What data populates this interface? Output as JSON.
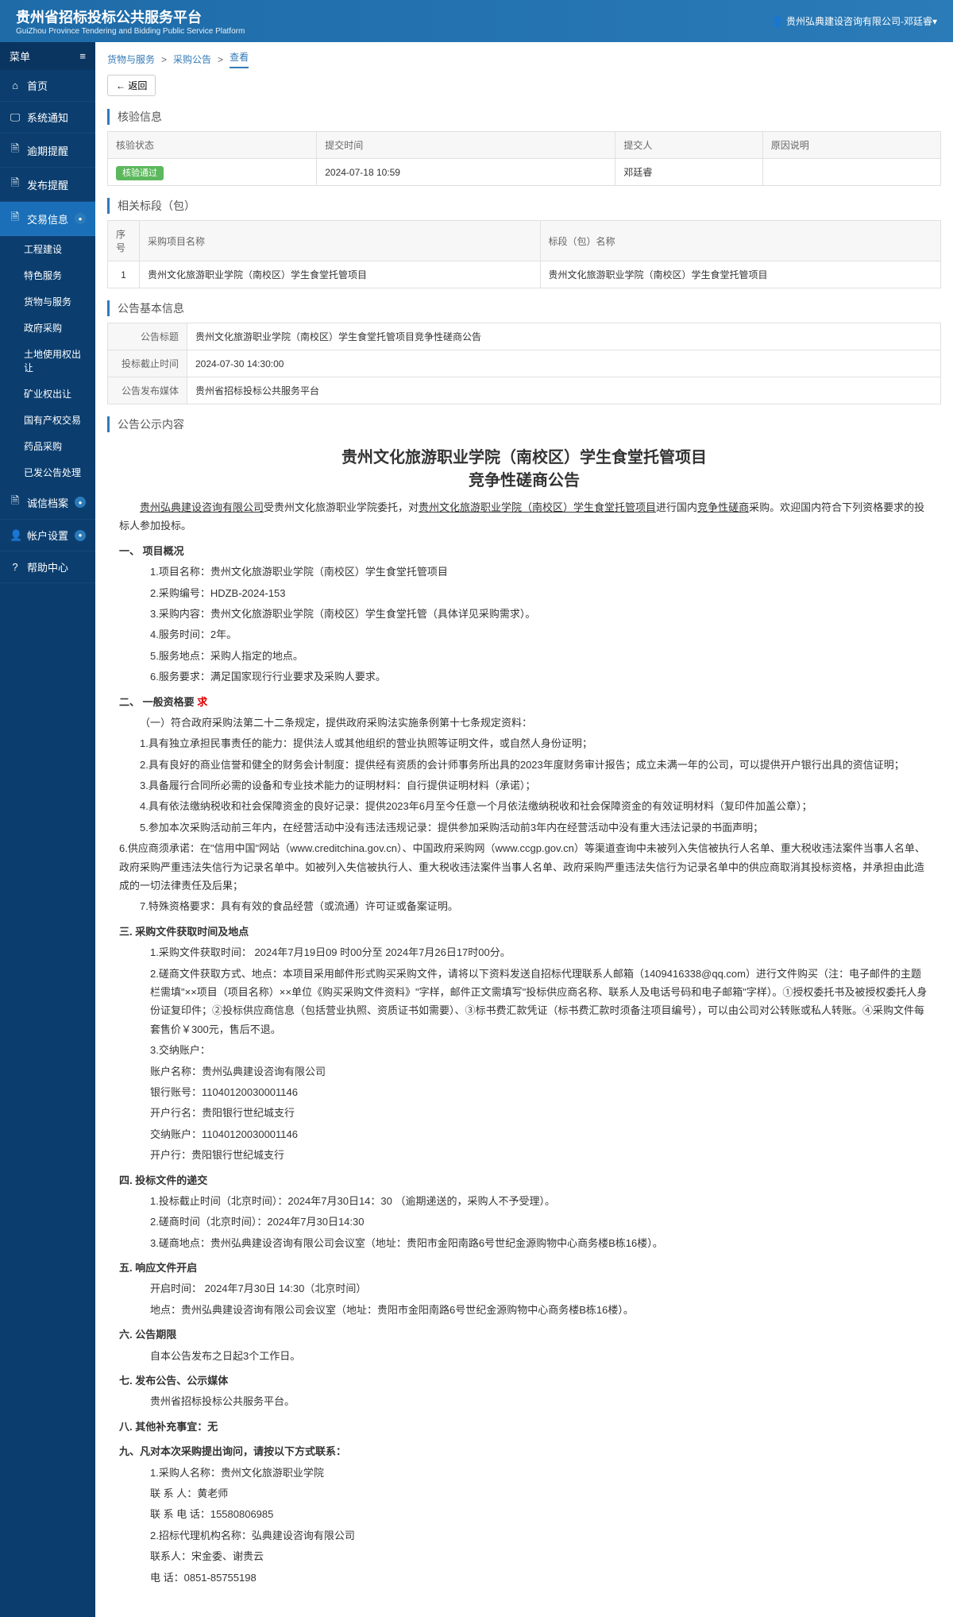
{
  "header": {
    "title": "贵州省招标投标公共服务平台",
    "subtitle": "GuiZhou Province Tendering and Bidding Public Service Platform",
    "user": "贵州弘典建设咨询有限公司-邓廷睿"
  },
  "sidebar": {
    "menu_label": "菜单",
    "items": [
      {
        "icon": "⌂",
        "label": "首页"
      },
      {
        "icon": "🖵",
        "label": "系统通知"
      },
      {
        "icon": "🗎",
        "label": "逾期提醒"
      },
      {
        "icon": "🗎",
        "label": "发布提醒"
      },
      {
        "icon": "🗎",
        "label": "交易信息",
        "active": true,
        "badge": true
      }
    ],
    "subitems": [
      {
        "label": "工程建设"
      },
      {
        "label": "特色服务"
      },
      {
        "label": "货物与服务"
      },
      {
        "label": "政府采购"
      },
      {
        "label": "土地使用权出让"
      },
      {
        "label": "矿业权出让"
      },
      {
        "label": "国有产权交易"
      },
      {
        "label": "药品采购"
      },
      {
        "label": "已发公告处理"
      }
    ],
    "bottom_items": [
      {
        "icon": "🗎",
        "label": "诚信档案",
        "badge": true
      },
      {
        "icon": "👤",
        "label": "帐户设置",
        "badge": true
      },
      {
        "icon": "?",
        "label": "帮助中心"
      }
    ]
  },
  "breadcrumb": {
    "items": [
      "货物与服务",
      "采购公告",
      "查看"
    ]
  },
  "back_btn": "← 返回",
  "verify": {
    "title": "核验信息",
    "headers": [
      "核验状态",
      "提交时间",
      "提交人",
      "原因说明"
    ],
    "status": "核验通过",
    "time": "2024-07-18 10:59",
    "person": "邓廷睿",
    "reason": ""
  },
  "section": {
    "title": "相关标段（包）",
    "headers": [
      "序号",
      "采购项目名称",
      "标段（包）名称"
    ],
    "rows": [
      {
        "no": "1",
        "proj": "贵州文化旅游职业学院（南校区）学生食堂托管项目",
        "pkg": "贵州文化旅游职业学院（南校区）学生食堂托管项目"
      }
    ]
  },
  "basic": {
    "title": "公告基本信息",
    "rows": [
      {
        "label": "公告标题",
        "value": "贵州文化旅游职业学院（南校区）学生食堂托管项目竞争性磋商公告"
      },
      {
        "label": "投标截止时间",
        "value": "2024-07-30 14:30:00"
      },
      {
        "label": "公告发布媒体",
        "value": "贵州省招标投标公共服务平台"
      }
    ]
  },
  "notice": {
    "panel_title": "公告公示内容",
    "title1": "贵州文化旅游职业学院（南校区）学生食堂托管项目",
    "title2": "竞争性磋商公告",
    "intro_a": "贵州弘典建设咨询有限公司",
    "intro_b": "受贵州文化旅游职业学院委托，对",
    "intro_c": "贵州文化旅游职业学院（南校区）学生食堂托管项目",
    "intro_d": "进行国内",
    "intro_e": "竞争性磋商",
    "intro_f": "采购。欢迎国内符合下列资格要求的投标人参加投标。",
    "s1_title": "一、  项目概况",
    "s1_1": "1.项目名称：贵州文化旅游职业学院（南校区）学生食堂托管项目",
    "s1_2": "2.采购编号：HDZB-2024-153",
    "s1_3": "3.采购内容：贵州文化旅游职业学院（南校区）学生食堂托管（具体详见采购需求）。",
    "s1_4": "4.服务时间：2年。",
    "s1_5": "5.服务地点：采购人指定的地点。",
    "s1_6": "6.服务要求：满足国家现行行业要求及采购人要求。",
    "s2_title": "二、  一般资格要",
    "s2_1": "（一）符合政府采购法第二十二条规定，提供政府采购法实施条例第十七条规定资料：",
    "s2_2": "1.具有独立承担民事责任的能力：提供法人或其他组织的营业执照等证明文件，或自然人身份证明；",
    "s2_3": "2.具有良好的商业信誉和健全的财务会计制度：提供经有资质的会计师事务所出具的2023年度财务审计报告；成立未满一年的公司，可以提供开户银行出具的资信证明；",
    "s2_4": "3.具备履行合同所必需的设备和专业技术能力的证明材料：自行提供证明材料（承诺）；",
    "s2_5": "4.具有依法缴纳税收和社会保障资金的良好记录：提供2023年6月至今任意一个月依法缴纳税收和社会保障资金的有效证明材料（复印件加盖公章）；",
    "s2_6": "5.参加本次采购活动前三年内，在经营活动中没有违法违规记录：提供参加采购活动前3年内在经营活动中没有重大违法记录的书面声明；",
    "s2_7": "6.供应商须承诺：在\"信用中国\"网站（www.creditchina.gov.cn）、中国政府采购网（www.ccgp.gov.cn）等渠道查询中未被列入失信被执行人名单、重大税收违法案件当事人名单、政府采购严重违法失信行为记录名单中。如被列入失信被执行人、重大税收违法案件当事人名单、政府采购严重违法失信行为记录名单中的供应商取消其投标资格，并承担由此造成的一切法律责任及后果；",
    "s2_8": "7.特殊资格要求：具有有效的食品经营（或流通）许可证或备案证明。",
    "s3_title": "三. 采购文件获取时间及地点",
    "s3_1": "1.采购文件获取时间：  2024年7月19日09 时00分至  2024年7月26日17时00分。",
    "s3_2": "2.磋商文件获取方式、地点：本项目采用邮件形式购买采购文件，请将以下资料发送自招标代理联系人邮箱（1409416338@qq.com）进行文件购买（注：电子邮件的主题栏需填\"××项目（项目名称）××单位《购买采购文件资料》\"字样，邮件正文需填写\"投标供应商名称、联系人及电话号码和电子邮箱\"字样）。①授权委托书及被授权委托人身份证复印件；②投标供应商信息（包括营业执照、资质证书如需要）、③标书费汇款凭证（标书费汇款时须备注项目编号），可以由公司对公转账或私人转账。④采购文件每套售价￥300元，售后不退。",
    "s3_3": "3.交纳账户：",
    "s3_4": "账户名称：贵州弘典建设咨询有限公司",
    "s3_5": "银行账号：11040120030001146",
    "s3_6": "开户行名：贵阳银行世纪城支行",
    "s3_7": "交纳账户：11040120030001146",
    "s3_8": "开户行：贵阳银行世纪城支行",
    "s4_title": "四. 投标文件的递交",
    "s4_1": "1.投标截止时间（北京时间）：2024年7月30日14：30      （逾期递送的，采购人不予受理）。",
    "s4_2": "2.磋商时间（北京时间）：2024年7月30日14:30",
    "s4_3": "3.磋商地点：贵州弘典建设咨询有限公司会议室（地址：贵阳市金阳南路6号世纪金源购物中心商务楼B栋16楼）。",
    "s5_title": "五. 响应文件开启",
    "s5_1": "开启时间： 2024年7月30日 14:30（北京时间）",
    "s5_2": "地点：贵州弘典建设咨询有限公司会议室（地址：贵阳市金阳南路6号世纪金源购物中心商务楼B栋16楼）。",
    "s6_title": "六. 公告期限",
    "s6_1": "自本公告发布之日起3个工作日。",
    "s7_title": "七.    发布公告、公示媒体",
    "s7_1": "贵州省招标投标公共服务平台。",
    "s8_title": "八. 其他补充事宜：无",
    "s9_title": "九、凡对本次采购提出询问，请按以下方式联系：",
    "s9_1": "1.采购人名称：贵州文化旅游职业学院",
    "s9_2": "联    系    人：黄老师",
    "s9_3": "联 系 电  话：15580806985",
    "s9_4": "2.招标代理机构名称：弘典建设咨询有限公司",
    "s9_5": "联系人：宋金委、谢贵云",
    "s9_6": "电      话：0851-85755198"
  }
}
